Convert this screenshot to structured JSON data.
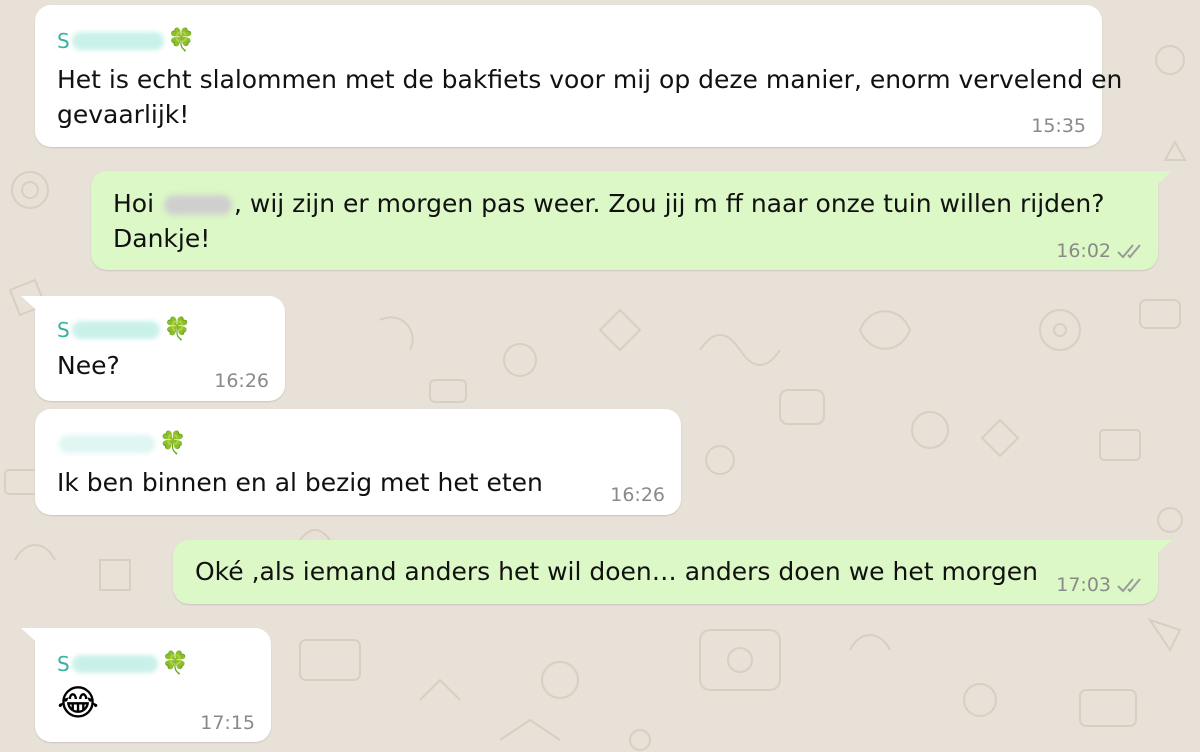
{
  "chat": {
    "contact_initial": "S",
    "contact_clover": "🍀",
    "messages": [
      {
        "direction": "incoming",
        "sender_initial": "S",
        "lines": [
          "Het is echt slalommen met de bakfiets voor mij op deze manier, enorm vervelend en",
          "gevaarlijk!"
        ],
        "time": "15:35"
      },
      {
        "direction": "outgoing",
        "line1_before": "Hoi",
        "line1_after": ", wij zijn er morgen pas weer. Zou jij m ff naar onze tuin willen rijden?",
        "line2": "Dankje!",
        "time": "16:02",
        "status": "read-double-check"
      },
      {
        "direction": "incoming",
        "sender_initial": "S",
        "lines": [
          "Nee?"
        ],
        "time": "16:26"
      },
      {
        "direction": "incoming",
        "sender_initial": "",
        "lines": [
          "Ik ben binnen en al bezig met het eten"
        ],
        "time": "16:26"
      },
      {
        "direction": "outgoing",
        "lines": [
          "Oké ,als iemand anders het wil doen… anders doen we het morgen"
        ],
        "time": "17:03",
        "status": "read-double-check"
      },
      {
        "direction": "incoming",
        "sender_initial": "S",
        "emoji": "😂",
        "time": "17:15"
      }
    ]
  },
  "colors": {
    "wallpaper": "#e8e1d8",
    "incoming_bubble": "#ffffff",
    "outgoing_bubble": "#dcf8c6",
    "sender_name": "#35b2a1",
    "timestamp": "#8a8a8a"
  }
}
